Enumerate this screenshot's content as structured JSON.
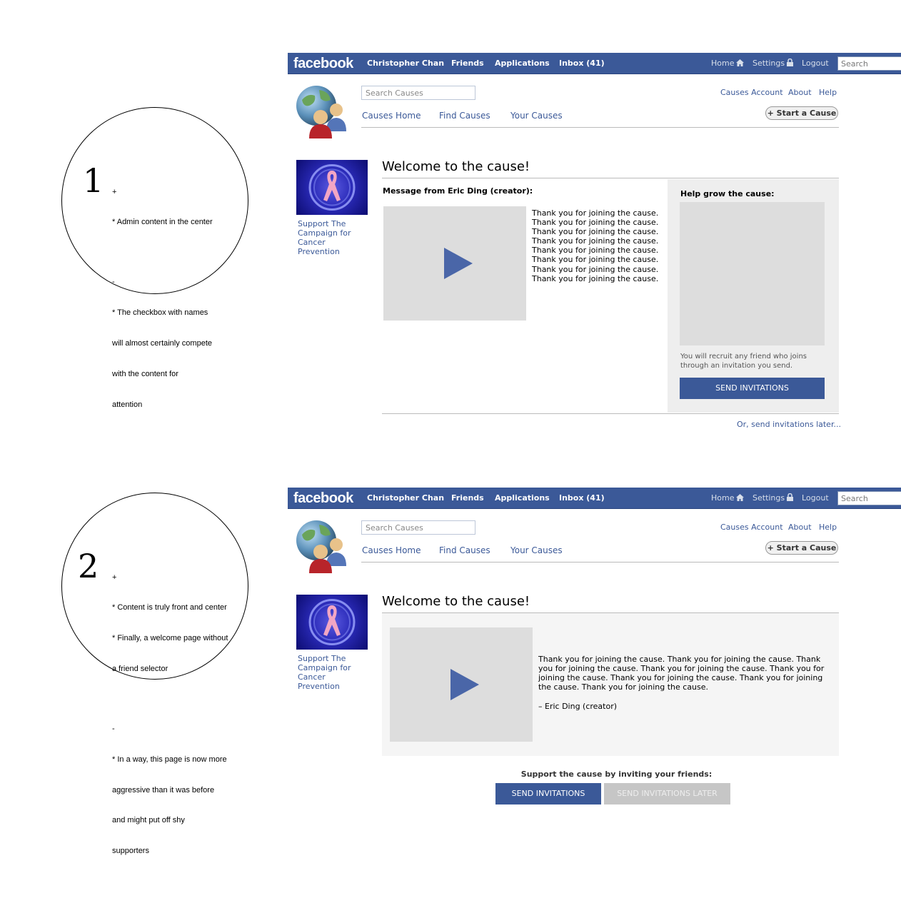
{
  "annotations": [
    {
      "number": "1",
      "lines": [
        "+",
        "* Admin content in the center",
        "",
        "-",
        "* The checkbox with names",
        "will almost certainly compete",
        "with the content for",
        "attention"
      ]
    },
    {
      "number": "2",
      "lines": [
        "+",
        "* Content is truly front and center",
        "* Finally, a welcome page without",
        "a friend selector",
        "",
        "-",
        "* In a way, this page is now more",
        "aggressive than it was before",
        "and might put off shy",
        "supporters"
      ]
    }
  ],
  "fbbar": {
    "logo": "facebook",
    "user": "Christopher Chan",
    "friends": "Friends",
    "applications": "Applications",
    "inbox": "Inbox (41)",
    "home": "Home",
    "settings": "Settings",
    "logout": "Logout",
    "search_placeholder": "Search"
  },
  "causes_header": {
    "search_placeholder": "Search Causes",
    "tabs": [
      "Causes Home",
      "Find Causes",
      "Your Causes"
    ],
    "top_links": [
      "Causes Account",
      "About",
      "Help"
    ],
    "start_cause": "Start a Cause"
  },
  "cause": {
    "name": "Support The Campaign for Cancer Prevention"
  },
  "mockup1": {
    "welcome_title": "Welcome to the cause!",
    "message_heading": "Message from Eric Ding (creator):",
    "message_lines": [
      "Thank you for joining the cause.",
      "Thank you for joining the cause.",
      "Thank you for joining the cause.",
      "Thank you for joining the cause.",
      "Thank you for joining the cause.",
      "Thank you for joining the cause.",
      "Thank you for joining the cause.",
      "Thank you for joining the cause."
    ],
    "help_heading": "Help grow the cause:",
    "recruit_note": "You will recruit any friend who joins through an invitation you send.",
    "send_invitations": "SEND INVITATIONS",
    "later_link": "Or, send invitations later..."
  },
  "mockup2": {
    "welcome_title": "Welcome to the cause!",
    "message_text": "Thank you for joining the cause. Thank you for joining the cause. Thank you for joining the cause. Thank you for joining the cause. Thank you for joining the cause. Thank you for joining the cause. Thank you for joining the cause. Thank you for joining the cause.",
    "signature": "– Eric Ding (creator)",
    "invite_prompt": "Support the cause by inviting your friends:",
    "send_invitations": "SEND INVITATIONS",
    "send_later": "SEND INVITATIONS LATER"
  },
  "colors": {
    "fb_blue": "#3b5998",
    "link_blue": "#3b5998",
    "video_grey": "#dddddd",
    "panel_grey": "#eeeeee",
    "disabled_button": "#c6c6c6"
  }
}
